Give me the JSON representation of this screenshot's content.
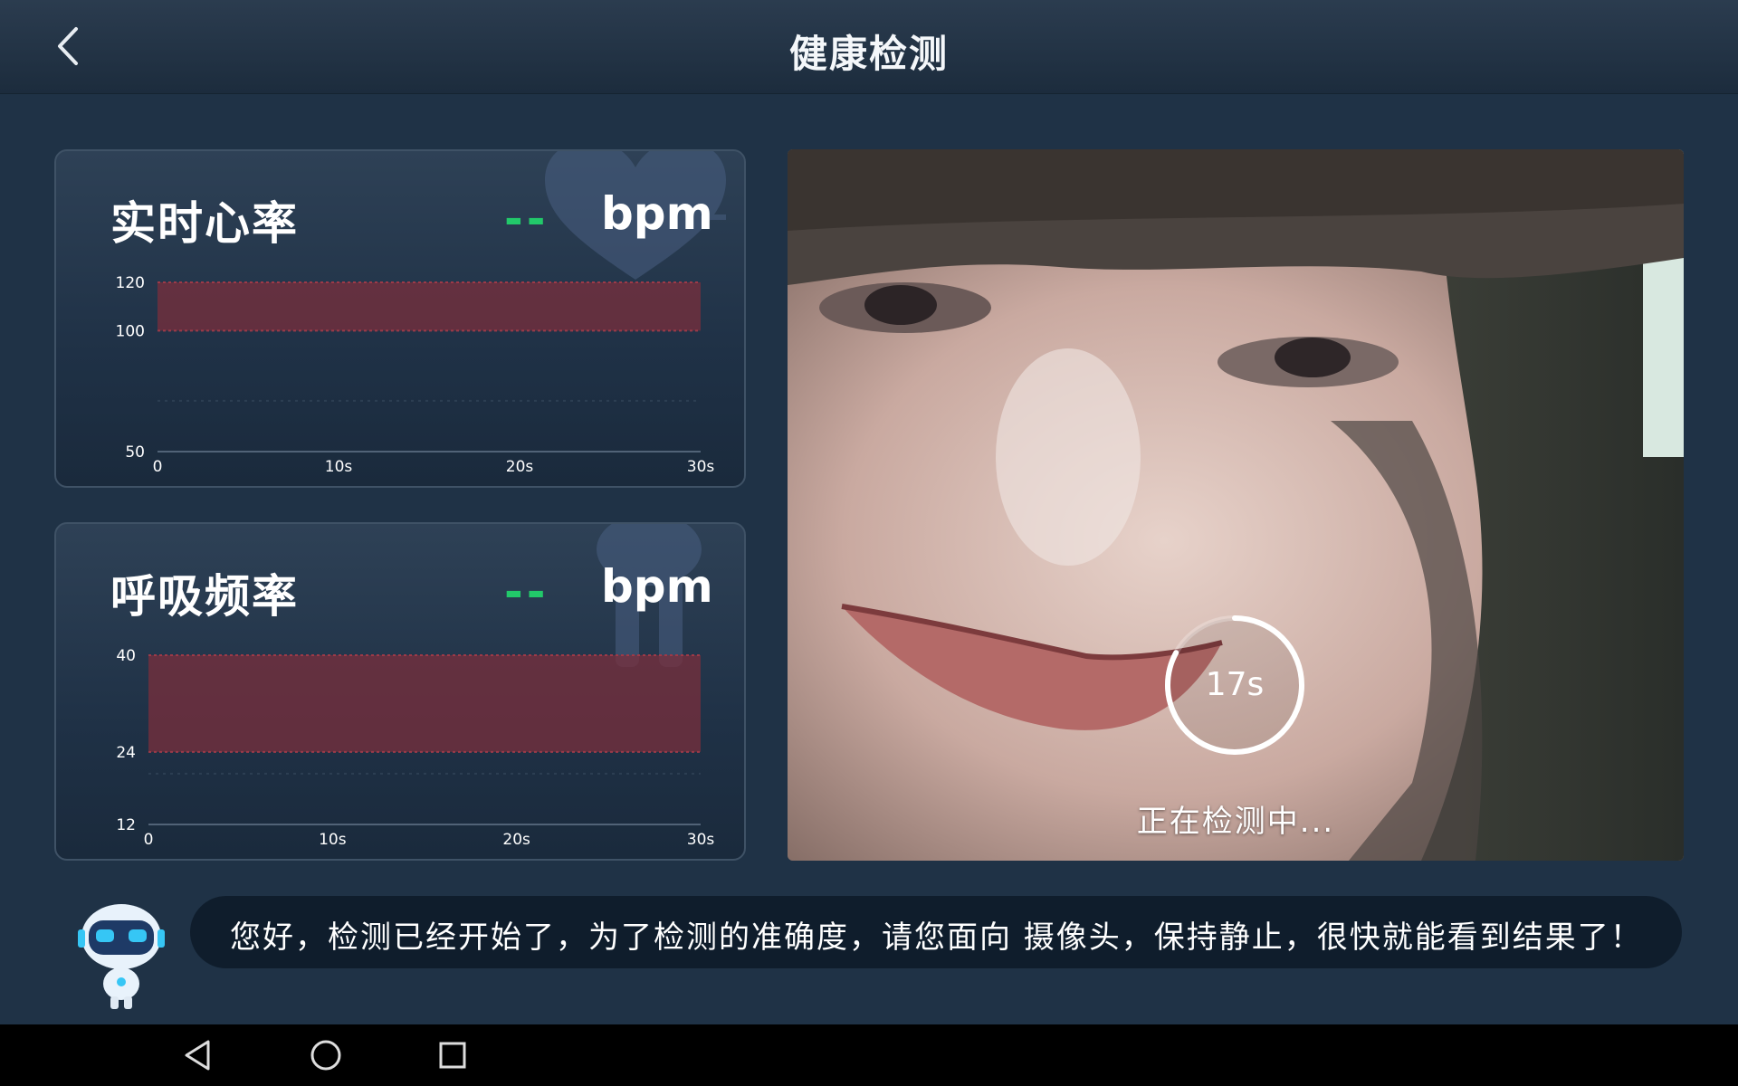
{
  "header": {
    "title": "健康检测",
    "back_icon": "chevron-left-icon"
  },
  "heart_rate": {
    "title": "实时心率",
    "value": "--",
    "unit": "bpm",
    "bg_icon": "heart-icon"
  },
  "respiration": {
    "title": "呼吸频率",
    "value": "--",
    "unit": "bpm",
    "bg_icon": "lungs-icon"
  },
  "chart_data": [
    {
      "type": "area",
      "title": "实时心率",
      "x_ticks": [
        "0",
        "10s",
        "20s",
        "30s"
      ],
      "y_ticks": [
        "120",
        "100",
        "50"
      ],
      "ylim": [
        50,
        120
      ],
      "xlim": [
        0,
        30
      ],
      "band": [
        100,
        120
      ],
      "series": []
    },
    {
      "type": "area",
      "title": "呼吸频率",
      "x_ticks": [
        "0",
        "10s",
        "20s",
        "30s"
      ],
      "y_ticks": [
        "40",
        "24",
        "12"
      ],
      "ylim": [
        12,
        40
      ],
      "xlim": [
        0,
        30
      ],
      "band": [
        24,
        40
      ],
      "series": []
    }
  ],
  "camera": {
    "timer": "17s",
    "timer_progress": 0.83,
    "status": "正在检测中..."
  },
  "message": {
    "text": "您好，检测已经开始了，为了检测的准确度，请您面向 摄像头，保持静止，很快就能看到结果了！",
    "avatar": "robot-assistant-icon"
  },
  "navbar": {
    "back": "nav-back-icon",
    "home": "nav-home-icon",
    "recents": "nav-recents-icon"
  },
  "colors": {
    "accent_value": "#22c96a",
    "band": "#7a2f3c",
    "background": "#1f3246"
  }
}
